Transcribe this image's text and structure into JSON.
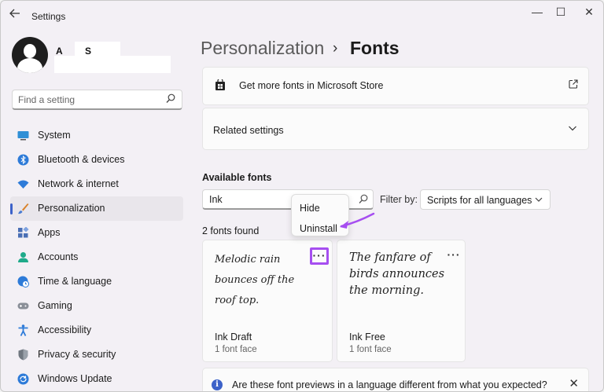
{
  "app": {
    "title": "Settings",
    "back_icon": "back-arrow-icon",
    "controls": {
      "minimize": "—",
      "maximize": "☐",
      "close": "✕"
    }
  },
  "user": {
    "initial_1": "A",
    "initial_2": "S"
  },
  "sidebar": {
    "search_placeholder": "Find a setting",
    "items": [
      {
        "label": "System",
        "icon": "system-icon",
        "active": false
      },
      {
        "label": "Bluetooth & devices",
        "icon": "bluetooth-icon",
        "active": false
      },
      {
        "label": "Network & internet",
        "icon": "wifi-icon",
        "active": false
      },
      {
        "label": "Personalization",
        "icon": "brush-icon",
        "active": true
      },
      {
        "label": "Apps",
        "icon": "apps-icon",
        "active": false
      },
      {
        "label": "Accounts",
        "icon": "account-icon",
        "active": false
      },
      {
        "label": "Time & language",
        "icon": "globe-clock-icon",
        "active": false
      },
      {
        "label": "Gaming",
        "icon": "gamepad-icon",
        "active": false
      },
      {
        "label": "Accessibility",
        "icon": "accessibility-icon",
        "active": false
      },
      {
        "label": "Privacy & security",
        "icon": "shield-icon",
        "active": false
      },
      {
        "label": "Windows Update",
        "icon": "update-icon",
        "active": false
      }
    ]
  },
  "breadcrumb": {
    "parent": "Personalization",
    "separator": "›",
    "current": "Fonts"
  },
  "cards": {
    "store_label": "Get more fonts in Microsoft Store",
    "related_label": "Related settings"
  },
  "fonts": {
    "section_title": "Available fonts",
    "search_value": "Ink",
    "filter_label": "Filter by:",
    "filter_value": "Scripts for all languages",
    "found_text": "2 fonts found",
    "more_label": "···",
    "items": [
      {
        "preview": "Melodic rain bounces off the roof top.",
        "name": "Ink Draft",
        "faces": "1 font face"
      },
      {
        "preview": "The fanfare of birds announces the morning.",
        "name": "Ink Free",
        "faces": "1 font face"
      }
    ],
    "menu": {
      "hide": "Hide",
      "uninstall": "Uninstall"
    }
  },
  "banner": {
    "icon": "i",
    "text": "Are these font previews in a language different from what you expected?",
    "close": "✕"
  },
  "colors": {
    "accent": "#3c62c9",
    "highlight": "#a64ef0"
  }
}
